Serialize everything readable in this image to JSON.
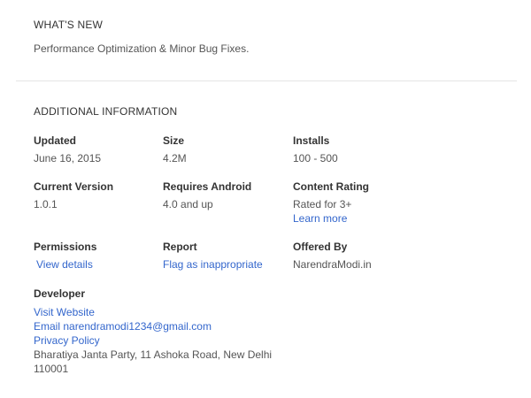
{
  "whats_new": {
    "title": "WHAT'S NEW",
    "text": "Performance Optimization & Minor Bug Fixes."
  },
  "additional_info": {
    "title": "ADDITIONAL INFORMATION",
    "updated": {
      "label": "Updated",
      "value": "June 16, 2015"
    },
    "size": {
      "label": "Size",
      "value": "4.2M"
    },
    "installs": {
      "label": "Installs",
      "value": "100 - 500"
    },
    "current_version": {
      "label": "Current Version",
      "value": "1.0.1"
    },
    "requires_android": {
      "label": "Requires Android",
      "value": "4.0 and up"
    },
    "content_rating": {
      "label": "Content Rating",
      "value": "Rated for 3+",
      "link": "Learn more"
    },
    "permissions": {
      "label": "Permissions",
      "link": "View details"
    },
    "report": {
      "label": "Report",
      "link": "Flag as inappropriate"
    },
    "offered_by": {
      "label": "Offered By",
      "value": "NarendraModi.in"
    },
    "developer": {
      "label": "Developer",
      "visit_website": "Visit Website",
      "email": "Email narendramodi1234@gmail.com",
      "privacy_policy": "Privacy Policy",
      "address": "Bharatiya Janta Party, 11 Ashoka Road, New Delhi 110001"
    }
  },
  "colors": {
    "link": "#3366cc",
    "divider": "#e5e5e5",
    "text": "#333333",
    "muted_text": "#555555"
  }
}
